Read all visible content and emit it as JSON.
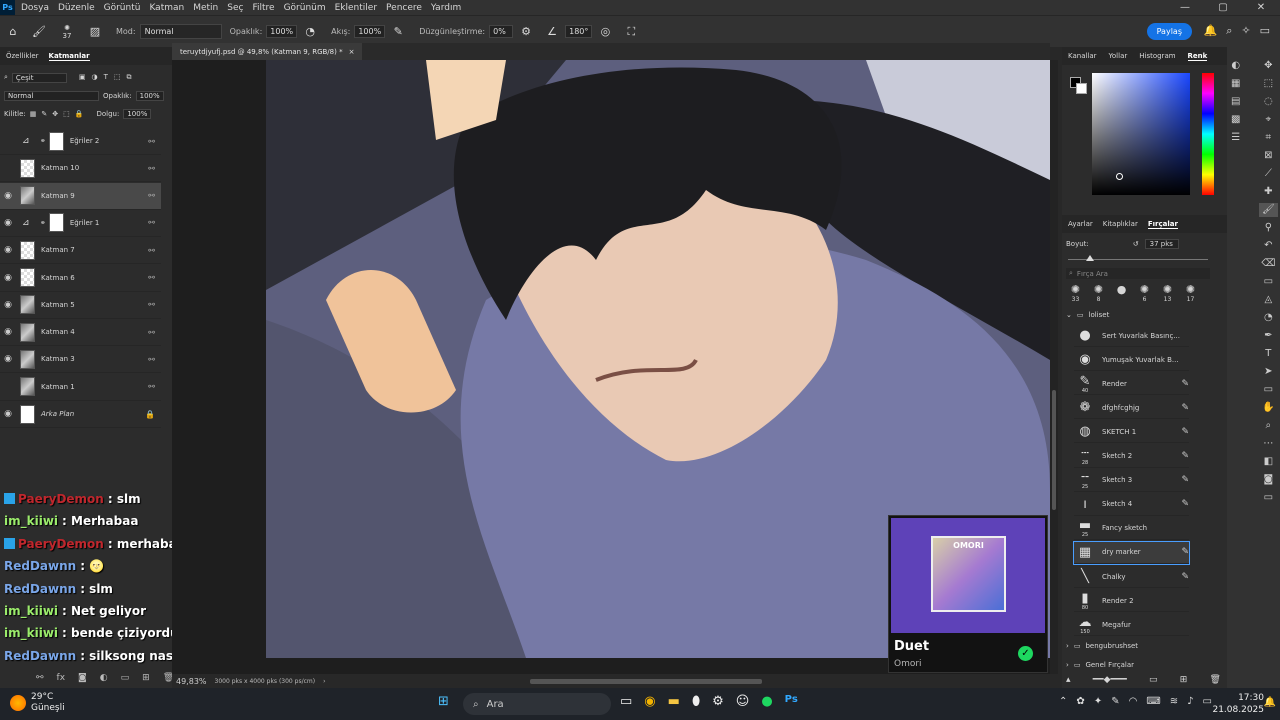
{
  "menubar": {
    "app_icon": "Ps",
    "items": [
      "Dosya",
      "Düzenle",
      "Görüntü",
      "Katman",
      "Metin",
      "Seç",
      "Filtre",
      "Görünüm",
      "Eklentiler",
      "Pencere",
      "Yardım"
    ],
    "window_controls": [
      "—",
      "▢",
      "✕"
    ]
  },
  "options": {
    "brush_size": "37",
    "mode_label": "Mod:",
    "mode_value": "Normal",
    "opacity_label": "Opaklık:",
    "opacity_value": "100%",
    "flow_label": "Akış:",
    "flow_value": "100%",
    "smoothing_label": "Düzgünleştirme:",
    "smoothing_value": "0%",
    "angle_value": "180°",
    "share_label": "Paylaş"
  },
  "layers_panel": {
    "tabs": [
      "Özellikler",
      "Katmanlar"
    ],
    "active_tab": "Katmanlar",
    "filter": "Çeşit",
    "blend_mode": "Normal",
    "opacity_label": "Opaklık:",
    "opacity_value": "100%",
    "lock_label": "Kilitle:",
    "fill_label": "Dolgu:",
    "fill_value": "100%",
    "layers": [
      {
        "name": "Eğriler 2",
        "visible": false,
        "kind": "adjust",
        "selected": false,
        "italic": false
      },
      {
        "name": "Katman 10",
        "visible": false,
        "kind": "empty",
        "selected": false,
        "italic": false
      },
      {
        "name": "Katman 9",
        "visible": true,
        "kind": "pic",
        "selected": true,
        "italic": false
      },
      {
        "name": "Eğriler 1",
        "visible": true,
        "kind": "adjust",
        "selected": false,
        "italic": false
      },
      {
        "name": "Katman 7",
        "visible": true,
        "kind": "empty",
        "selected": false,
        "italic": false
      },
      {
        "name": "Katman 6",
        "visible": true,
        "kind": "empty",
        "selected": false,
        "italic": false
      },
      {
        "name": "Katman 5",
        "visible": true,
        "kind": "pic",
        "selected": false,
        "italic": false
      },
      {
        "name": "Katman 4",
        "visible": true,
        "kind": "pic",
        "selected": false,
        "italic": false
      },
      {
        "name": "Katman 3",
        "visible": true,
        "kind": "pic",
        "selected": false,
        "italic": false
      },
      {
        "name": "Katman 1",
        "visible": false,
        "kind": "pic",
        "selected": false,
        "italic": false
      },
      {
        "name": "Arka Plan",
        "visible": true,
        "kind": "white",
        "selected": false,
        "italic": true
      }
    ]
  },
  "chat": [
    {
      "user": "PaeryDemon",
      "color": "red",
      "badge": true,
      "text": ": slm"
    },
    {
      "user": "im_kiiwi",
      "color": "green",
      "badge": false,
      "text": ": Merhabaa"
    },
    {
      "user": "PaeryDemon",
      "color": "red",
      "badge": true,
      "text": ": merhaba"
    },
    {
      "user": "RedDawnn",
      "color": "blue",
      "badge": false,
      "text": ": 🌝"
    },
    {
      "user": "RedDawnn",
      "color": "blue",
      "badge": false,
      "text": ": slm"
    },
    {
      "user": "im_kiiwi",
      "color": "green",
      "badge": false,
      "text": ": Net geliyor"
    },
    {
      "user": "im_kiiwi",
      "color": "green",
      "badge": false,
      "text": ": bende çiziyordumm şimdi senle çiziyorum"
    },
    {
      "user": "RedDawnn",
      "color": "blue",
      "badge": false,
      "text": ": silksong nası gerçek a"
    }
  ],
  "document": {
    "tab_title": "teruytdjyufj.psd @ 49,8% (Katman 9, RGB/8) *",
    "zoom": "49,83%",
    "info": "3000 pks x 4000 pks (300 ps/cm)"
  },
  "right_panel": {
    "top_tabs": [
      "Kanallar",
      "Yollar",
      "Histogram",
      "Renk"
    ],
    "active_top": "Renk",
    "mid_tabs": [
      "Ayarlar",
      "Kitaplıklar",
      "Fırçalar"
    ],
    "active_mid": "Fırçalar",
    "size_label": "Boyut:",
    "size_value": "37 pks",
    "search_placeholder": "Fırça Ara",
    "recent_sizes": [
      "33",
      "8",
      "",
      "6",
      "13",
      "17"
    ],
    "folder_name": "loliset",
    "brushes": [
      {
        "name": "Sert Yuvarlak Basınç...",
        "size": "",
        "glyph": "●"
      },
      {
        "name": "Yumuşak Yuvarlak B...",
        "size": "",
        "glyph": "◉"
      },
      {
        "name": "Render",
        "size": "40",
        "glyph": "✎"
      },
      {
        "name": "dfghfcghjg",
        "size": "",
        "glyph": "❁"
      },
      {
        "name": "SKETCH 1",
        "size": "",
        "glyph": "◍"
      },
      {
        "name": "Sketch 2",
        "size": "28",
        "glyph": "┄"
      },
      {
        "name": "Sketch 3",
        "size": "25",
        "glyph": "╌"
      },
      {
        "name": "Sketch 4",
        "size": "",
        "glyph": "ı"
      },
      {
        "name": "Fancy sketch",
        "size": "25",
        "glyph": "▬"
      },
      {
        "name": "dry marker",
        "size": "",
        "glyph": "▦",
        "selected": true
      },
      {
        "name": "Chalky",
        "size": "",
        "glyph": "╲"
      },
      {
        "name": "Render 2",
        "size": "80",
        "glyph": "▮"
      },
      {
        "name": "Megafur",
        "size": "150",
        "glyph": "☁"
      }
    ],
    "folders": [
      "bengubrushset",
      "Genel Fırçalar"
    ]
  },
  "spotify": {
    "title": "Duet",
    "artist": "Omori",
    "cover_text": "OMORI"
  },
  "taskbar": {
    "temp": "29°C",
    "weather": "Güneşli",
    "search": "Ara",
    "time": "17:30",
    "date": "21.08.2025"
  }
}
